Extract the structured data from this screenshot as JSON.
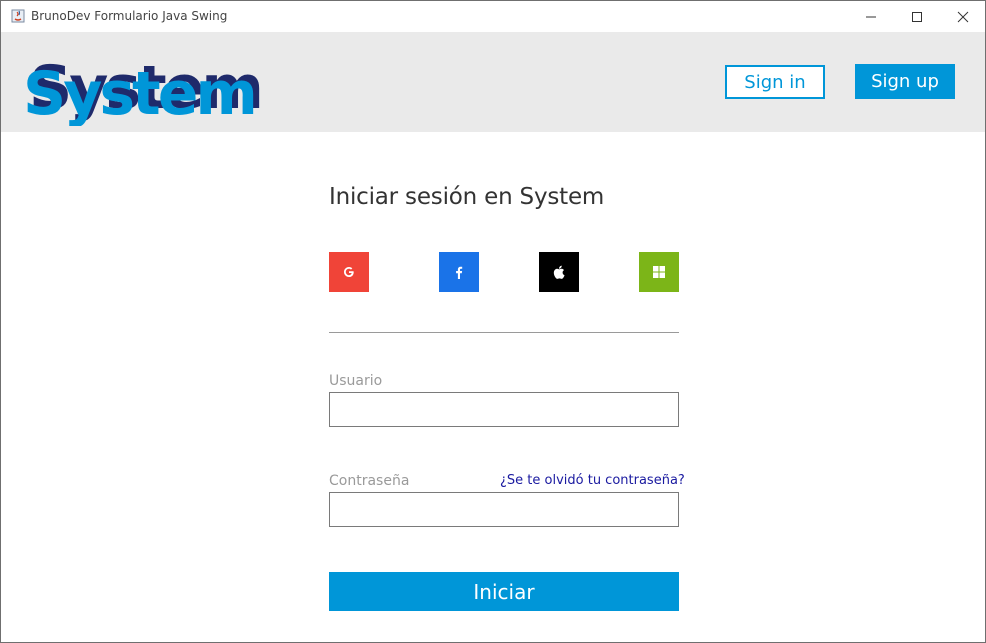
{
  "window": {
    "title": "BrunoDev Formulario Java Swing",
    "controls": [
      "minimize",
      "maximize",
      "close"
    ]
  },
  "header": {
    "logo_text": "System",
    "signin_label": "Sign in",
    "signup_label": "Sign up"
  },
  "login": {
    "heading": "Iniciar sesión en System",
    "social": [
      {
        "name": "google",
        "icon": "google-icon",
        "color": "#f04438"
      },
      {
        "name": "facebook",
        "icon": "facebook-icon",
        "color": "#1a73e8"
      },
      {
        "name": "apple",
        "icon": "apple-icon",
        "color": "#000000"
      },
      {
        "name": "windows",
        "icon": "windows-icon",
        "color": "#7cb518"
      }
    ],
    "usuario_label": "Usuario",
    "usuario_value": "",
    "password_label": "Contraseña",
    "password_value": "",
    "forgot_label": "¿Se te olvidó tu contraseña?",
    "submit_label": "Iniciar"
  },
  "colors": {
    "accent": "#0096d8",
    "header_bg": "#eaeaea",
    "logo_dark": "#1f2a6b",
    "logo_light": "#0096d8"
  }
}
